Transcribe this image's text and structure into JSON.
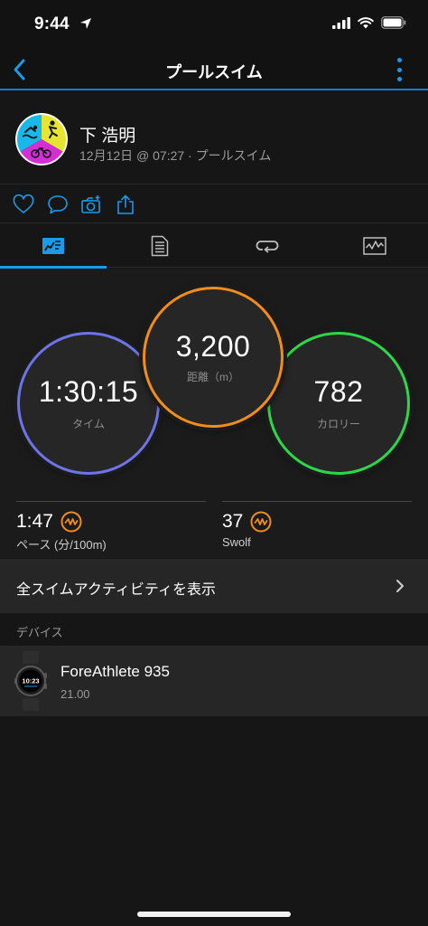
{
  "status_bar": {
    "time": "9:44"
  },
  "nav": {
    "title": "プールスイム"
  },
  "profile": {
    "name": "下 浩明",
    "meta": "12月12日 @ 07:27 · プールスイム"
  },
  "stats": {
    "time": {
      "value": "1:30:15",
      "label": "タイム",
      "color": "#6d74e8"
    },
    "distance": {
      "value": "3,200",
      "label": "距離（m）",
      "color": "#f28c1c"
    },
    "calories": {
      "value": "782",
      "label": "カロリー",
      "color": "#2ed64a"
    }
  },
  "metrics": [
    {
      "value": "1:47",
      "label": "ペース (分/100m)",
      "icon": "pace-trend-icon"
    },
    {
      "value": "37",
      "label": "Swolf",
      "icon": "swolf-trend-icon"
    }
  ],
  "view_all": {
    "label": "全スイムアクティビティを表示"
  },
  "devices_section": {
    "label": "デバイス"
  },
  "device": {
    "name": "ForeAthlete 935",
    "version": "21.00",
    "face_time": "10:23"
  },
  "colors": {
    "accent": "#1a9ae8",
    "background": "#161616",
    "card": "#262626",
    "warning_orange": "#f28c1c"
  }
}
